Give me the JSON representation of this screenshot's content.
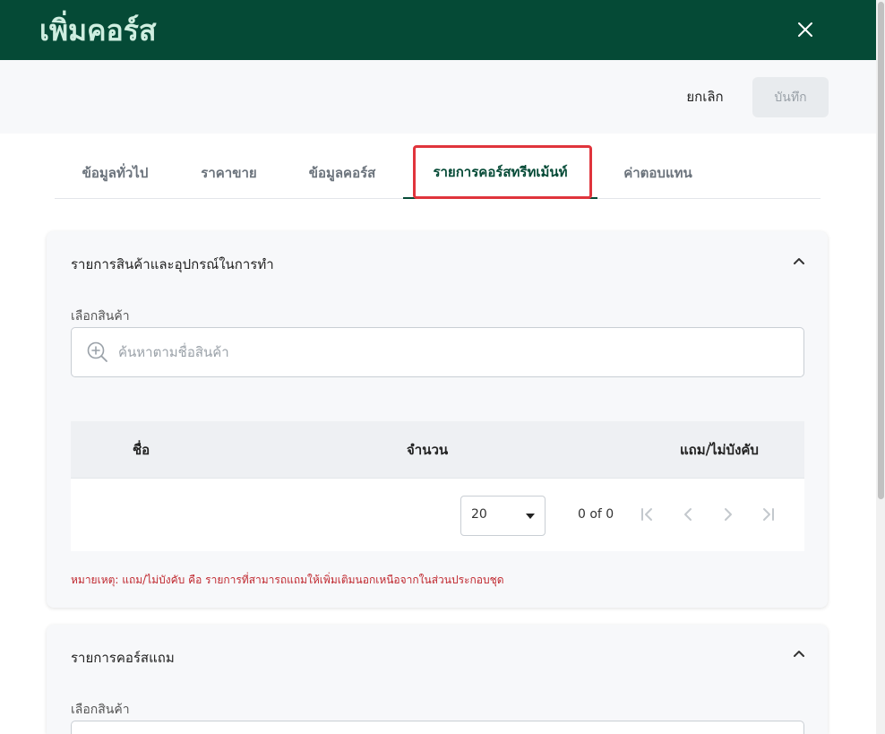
{
  "header": {
    "title": "เพิ่มคอร์ส",
    "close_icon": "close-icon",
    "background": "#054a36"
  },
  "actions": {
    "cancel_label": "ยกเลิก",
    "save_label": "บันทึก"
  },
  "tabs": [
    {
      "label": "ข้อมูลทั่วไป",
      "active": false
    },
    {
      "label": "ราคาขาย",
      "active": false
    },
    {
      "label": "ข้อมูลคอร์ส",
      "active": false
    },
    {
      "label": "รายการคอร์สทรีทเม้นท์",
      "active": true
    },
    {
      "label": "ค่าตอบแทน",
      "active": false
    }
  ],
  "section_products": {
    "title": "รายการสินค้าและอุปกรณ์ในการทำ",
    "select_label": "เลือกสินค้า",
    "search_placeholder": "ค้นหาตามชื่อสินค้า",
    "columns": [
      "ชื่อ",
      "จำนวน",
      "แถม/ไม่บังคับ"
    ],
    "rows": [],
    "page_size": "20",
    "page_info": "0 of 0",
    "note": "หมายเหตุ: แถม/ไม่บังคับ คือ รายการที่สามารถแถมให้เพิ่มเติมนอกเหนือจากในส่วนประกอบชุด"
  },
  "section_free": {
    "title": "รายการคอร์สแถม",
    "select_label": "เลือกสินค้า"
  },
  "colors": {
    "accent": "#054a36",
    "highlight": "#e0343c",
    "note": "#c0282f"
  }
}
